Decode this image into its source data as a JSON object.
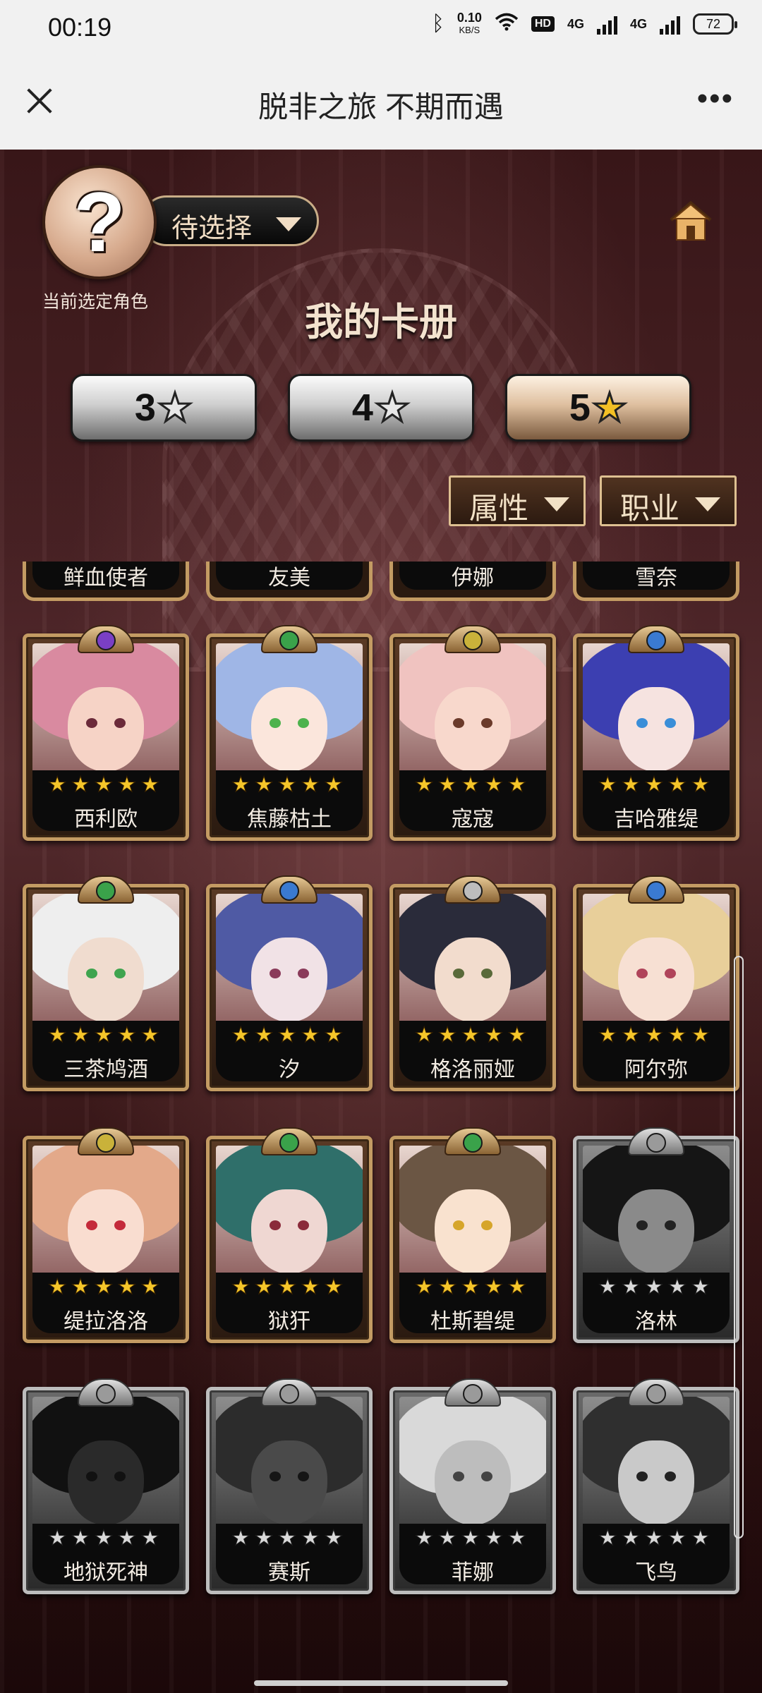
{
  "status_bar": {
    "time": "00:19",
    "speed_value": "0.10",
    "speed_unit": "KB/S",
    "hd_label": "HD",
    "net1": "4G",
    "net2": "4G",
    "battery": "72"
  },
  "titlebar": {
    "title": "脱非之旅 不期而遇",
    "more": "•••"
  },
  "header": {
    "avatar_placeholder": "?",
    "select_label": "待选择",
    "current_role_label": "当前选定角色",
    "page_title": "我的卡册"
  },
  "star_tabs": [
    {
      "num": "3",
      "star": "★",
      "active": false
    },
    {
      "num": "4",
      "star": "★",
      "active": false
    },
    {
      "num": "5",
      "star": "★",
      "active": true
    }
  ],
  "filters": {
    "attribute": "属性",
    "profession": "职业"
  },
  "partial_row": [
    "鲜血使者",
    "友美",
    "伊娜",
    "雪奈"
  ],
  "cards": [
    {
      "name": "西利欧",
      "stars": "★★★★★",
      "gray": false,
      "gem": "#7a3fc4",
      "hair": "#d98aa0",
      "skin": "#f6d3c6",
      "eye": "#6b2a3a"
    },
    {
      "name": "焦藤枯土",
      "stars": "★★★★★",
      "gray": false,
      "gem": "#3aa24a",
      "hair": "#9fb6e6",
      "skin": "#fbe6dc",
      "eye": "#4db24d"
    },
    {
      "name": "寇寇",
      "stars": "★★★★★",
      "gray": false,
      "gem": "#c9b23a",
      "hair": "#f0c3c0",
      "skin": "#f8d8cc",
      "eye": "#6b3a2a"
    },
    {
      "name": "吉哈雅缇",
      "stars": "★★★★★",
      "gray": false,
      "gem": "#3a7ad1",
      "hair": "#3c3fb1",
      "skin": "#f6e3e0",
      "eye": "#3a8ed8"
    },
    {
      "name": "三茶鸠酒",
      "stars": "★★★★★",
      "gray": false,
      "gem": "#3aa24a",
      "hair": "#eeeeee",
      "skin": "#f0dccf",
      "eye": "#3fa44f"
    },
    {
      "name": "汐",
      "stars": "★★★★★",
      "gray": false,
      "gem": "#3a7ad1",
      "hair": "#4f5aa4",
      "skin": "#f1e2e6",
      "eye": "#8a3a5a"
    },
    {
      "name": "格洛丽娅",
      "stars": "★★★★★",
      "gray": false,
      "gem": "#bdbdbd",
      "hair": "#2a2b3a",
      "skin": "#f2dccd",
      "eye": "#5a6a3a"
    },
    {
      "name": "阿尔弥",
      "stars": "★★★★★",
      "gray": false,
      "gem": "#3a7ad1",
      "hair": "#e8cf9a",
      "skin": "#f7e0d3",
      "eye": "#b0445a"
    },
    {
      "name": "缇拉洛洛",
      "stars": "★★★★★",
      "gray": false,
      "gem": "#c9b23a",
      "hair": "#e3a98a",
      "skin": "#f9ddd0",
      "eye": "#c42a3a"
    },
    {
      "name": "狱犴",
      "stars": "★★★★★",
      "gray": false,
      "gem": "#3aa24a",
      "hair": "#2f6f6a",
      "skin": "#efd7d2",
      "eye": "#8a2a3a"
    },
    {
      "name": "杜斯碧缇",
      "stars": "★★★★★",
      "gray": false,
      "gem": "#3aa24a",
      "hair": "#6b5644",
      "skin": "#f9e2cf",
      "eye": "#d6a52a"
    },
    {
      "name": "洛林",
      "stars": "★★★★★",
      "gray": true,
      "gem": "#9a9a9a",
      "hair": "#151515",
      "skin": "#8a8a8a",
      "eye": "#222222"
    },
    {
      "name": "地狱死神",
      "stars": "★★★★★",
      "gray": true,
      "gem": "#9a9a9a",
      "hair": "#111111",
      "skin": "#2a2a2a",
      "eye": "#111111"
    },
    {
      "name": "赛斯",
      "stars": "★★★★★",
      "gray": true,
      "gem": "#9a9a9a",
      "hair": "#2c2c2c",
      "skin": "#4a4a4a",
      "eye": "#151515"
    },
    {
      "name": "菲娜",
      "stars": "★★★★★",
      "gray": true,
      "gem": "#9a9a9a",
      "hair": "#d9d9d9",
      "skin": "#bdbdbd",
      "eye": "#444444"
    },
    {
      "name": "飞鸟",
      "stars": "★★★★★",
      "gray": true,
      "gem": "#9a9a9a",
      "hair": "#2f2f2f",
      "skin": "#c9c9c9",
      "eye": "#222222"
    }
  ]
}
